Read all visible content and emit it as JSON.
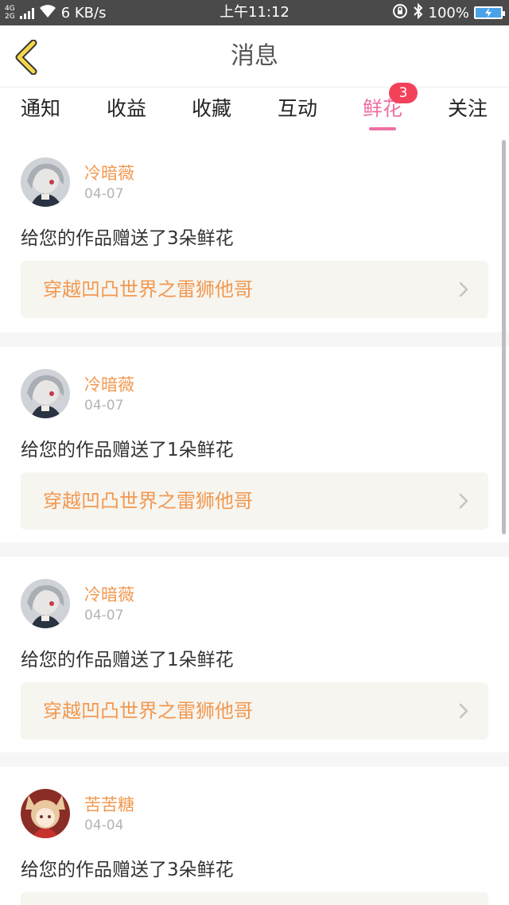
{
  "status_bar": {
    "network_top": "4G",
    "network_bottom": "2G",
    "speed": "6 KB/s",
    "time": "上午11:12",
    "battery_percent": "100%",
    "icons": [
      "signal-icon",
      "wifi-icon",
      "lock-rotation-icon",
      "bluetooth-icon",
      "battery-charging-icon"
    ]
  },
  "header": {
    "title": "消息",
    "back_icon": "chevron-left-icon",
    "accent_color": "#f5d84a"
  },
  "tabs": [
    {
      "label": "通知",
      "active": false
    },
    {
      "label": "收益",
      "active": false
    },
    {
      "label": "收藏",
      "active": false
    },
    {
      "label": "互动",
      "active": false
    },
    {
      "label": "鲜花",
      "active": true,
      "badge": "3"
    },
    {
      "label": "关注",
      "active": false
    }
  ],
  "colors": {
    "active_tab": "#ee6fa5",
    "badge": "#f4415a",
    "username": "#f2984f",
    "link_bg": "#f6f5f0"
  },
  "messages": [
    {
      "user": "冷暗薇",
      "date": "04-07",
      "text": "给您的作品赠送了3朵鲜花",
      "work": "穿越凹凸世界之雷狮他哥",
      "avatar": "avatar-gray-haired"
    },
    {
      "user": "冷暗薇",
      "date": "04-07",
      "text": "给您的作品赠送了1朵鲜花",
      "work": "穿越凹凸世界之雷狮他哥",
      "avatar": "avatar-gray-haired"
    },
    {
      "user": "冷暗薇",
      "date": "04-07",
      "text": "给您的作品赠送了1朵鲜花",
      "work": "穿越凹凸世界之雷狮他哥",
      "avatar": "avatar-gray-haired"
    },
    {
      "user": "苦苦糖",
      "date": "04-04",
      "text": "给您的作品赠送了3朵鲜花",
      "work": "",
      "avatar": "avatar-fox-girl"
    }
  ]
}
